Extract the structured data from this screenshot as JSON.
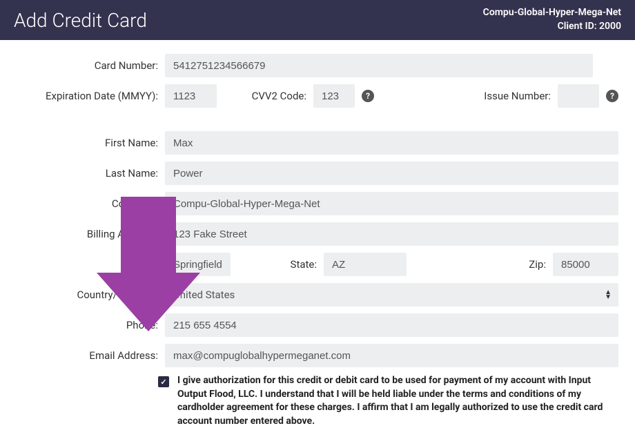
{
  "header": {
    "title": "Add Credit Card",
    "company": "Compu-Global-Hyper-Mega-Net",
    "client_id_label": "Client ID: 2000"
  },
  "form": {
    "card_number_label": "Card Number:",
    "card_number_value": "5412751234566679",
    "expiration_label": "Expiration Date (MMYY):",
    "expiration_value": "1123",
    "cvv_label": "CVV2 Code:",
    "cvv_value": "123",
    "issue_label": "Issue Number:",
    "issue_value": "",
    "first_name_label": "First Name:",
    "first_name_value": "Max",
    "last_name_label": "Last Name:",
    "last_name_value": "Power",
    "company_label": "Company:",
    "company_value": "Compu-Global-Hyper-Mega-Net",
    "billing_label": "Billing Address:",
    "billing_value": "123 Fake Street",
    "city_value": "Springfield",
    "state_label": "State:",
    "state_value": "AZ",
    "zip_label": "Zip:",
    "zip_value": "85000",
    "country_label": "Country/Territory:",
    "country_value": "United States",
    "phone_label": "Phone:",
    "phone_value": "215 655 4554",
    "email_label": "Email Address:",
    "email_value": "max@compuglobalhypermeganet.com",
    "consent_text": "I give authorization for this credit or debit card to be used for payment of my account with Input Output Flood, LLC. I understand that I will be held liable under the terms and conditions of my cardholder agreement for these charges. I affirm that I am legally authorized to use the credit card account number entered above."
  },
  "colors": {
    "arrow": "#9b3fa4"
  }
}
